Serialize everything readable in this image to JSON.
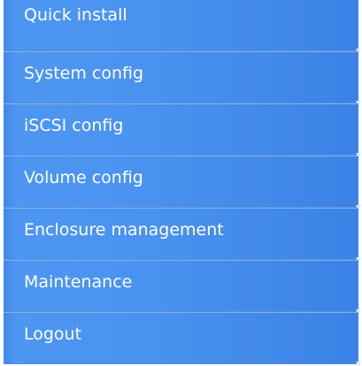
{
  "menu": {
    "items": [
      {
        "label": "Quick install",
        "icon": "chevron-down-icon"
      },
      {
        "label": "System config",
        "icon": "chevron-down-icon"
      },
      {
        "label": "iSCSI config",
        "icon": "chevron-down-icon"
      },
      {
        "label": "Volume config",
        "icon": "chevron-down-icon"
      },
      {
        "label": "Enclosure management",
        "icon": "chevron-down-icon"
      },
      {
        "label": "Maintenance",
        "icon": "chevron-down-icon"
      },
      {
        "label": "Logout",
        "icon": "chevron-down-icon"
      }
    ],
    "colors": {
      "background": "#ffffff",
      "item_gradient_start": "#4d97f2",
      "item_gradient_end": "#3b82e6",
      "separator": "#5d8dd1",
      "text": "#ffffff"
    }
  }
}
